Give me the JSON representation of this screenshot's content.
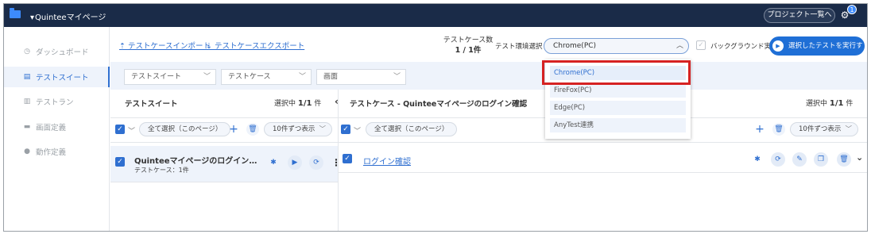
{
  "topbar": {
    "title": "Quinteeマイページ",
    "project_button": "プロジェクト一覧へ",
    "notification_count": "1"
  },
  "sidebar": {
    "items": [
      {
        "label": "ダッシュボード",
        "icon": "clock-icon",
        "active": false
      },
      {
        "label": "テストスイート",
        "icon": "list-icon",
        "active": true
      },
      {
        "label": "テストラン",
        "icon": "doc-icon",
        "active": false
      },
      {
        "label": "画面定義",
        "icon": "monitor-icon",
        "active": false
      },
      {
        "label": "動作定義",
        "icon": "gear-icon",
        "active": false
      }
    ]
  },
  "toolbar": {
    "import_link": "テストケースインポート",
    "export_link": "テストケースエクスポート",
    "count_label": "テストケース数",
    "count_value": "1 / 1件",
    "env_label": "テスト環境選択",
    "env_value": "Chrome(PC)",
    "background_label": "バックグラウンド実行",
    "run_button": "選択したテストを実行する"
  },
  "filters": {
    "suite": "テストスイート",
    "case": "テストケース",
    "screen": "画面"
  },
  "left_panel": {
    "title": "テストスイート",
    "selected_label": "選択中",
    "selected_value": "1/1",
    "selected_unit": "件",
    "select_all": "全て選択（このページ）",
    "page_size": "10件ずつ表示",
    "row_title": "Quinteeマイページのログイン確認",
    "row_sub": "テストケース：1件"
  },
  "right_panel": {
    "title": "テストケース - Quinteeマイページのログイン確認",
    "selected_label": "選択中",
    "selected_value": "1/1",
    "selected_unit": "件",
    "select_all": "全て選択（このページ）",
    "page_size": "10件ずつ表示",
    "row_link": "ログイン確認"
  },
  "dropdown": {
    "options": [
      "Chrome(PC)",
      "FireFox(PC)",
      "Edge(PC)",
      "AnyTest連携"
    ],
    "selected": "Chrome(PC)"
  },
  "colors": {
    "topbar": "#1a2b48",
    "accent": "#2f6fd0",
    "highlight": "#d62222"
  }
}
